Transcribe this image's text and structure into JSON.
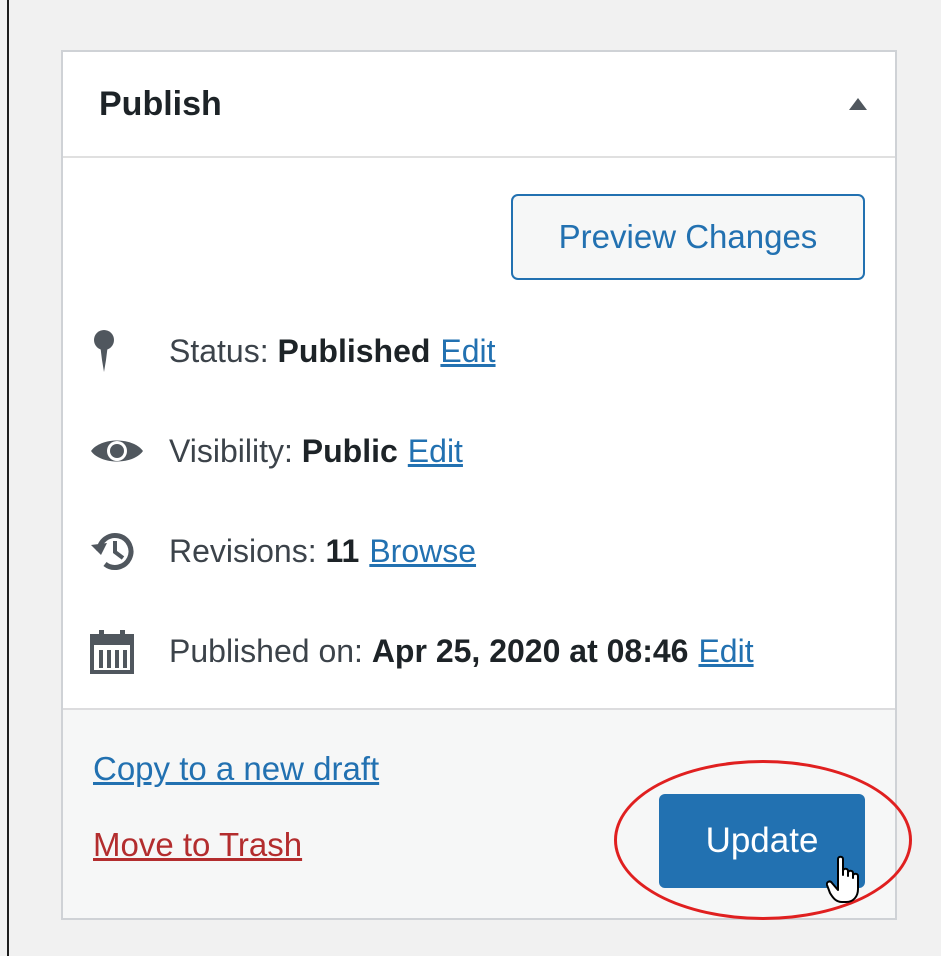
{
  "publish_box": {
    "title": "Publish",
    "preview_label": "Preview Changes",
    "status": {
      "prefix": "Status:",
      "value": "Published",
      "link": "Edit",
      "icon": "pin-icon"
    },
    "visibility": {
      "prefix": "Visibility:",
      "value": "Public",
      "link": "Edit",
      "icon": "eye-icon"
    },
    "revisions": {
      "prefix": "Revisions:",
      "value": "11",
      "link": "Browse",
      "icon": "history-icon"
    },
    "published_on": {
      "prefix": "Published on:",
      "value": "Apr 25, 2020 at 08:46",
      "link": "Edit",
      "icon": "calendar-icon"
    },
    "copy_draft_label": "Copy to a new draft",
    "trash_label": "Move to Trash",
    "update_label": "Update"
  },
  "colors": {
    "accent": "#2271b1",
    "danger": "#b32d2e",
    "highlight": "#e02020"
  }
}
